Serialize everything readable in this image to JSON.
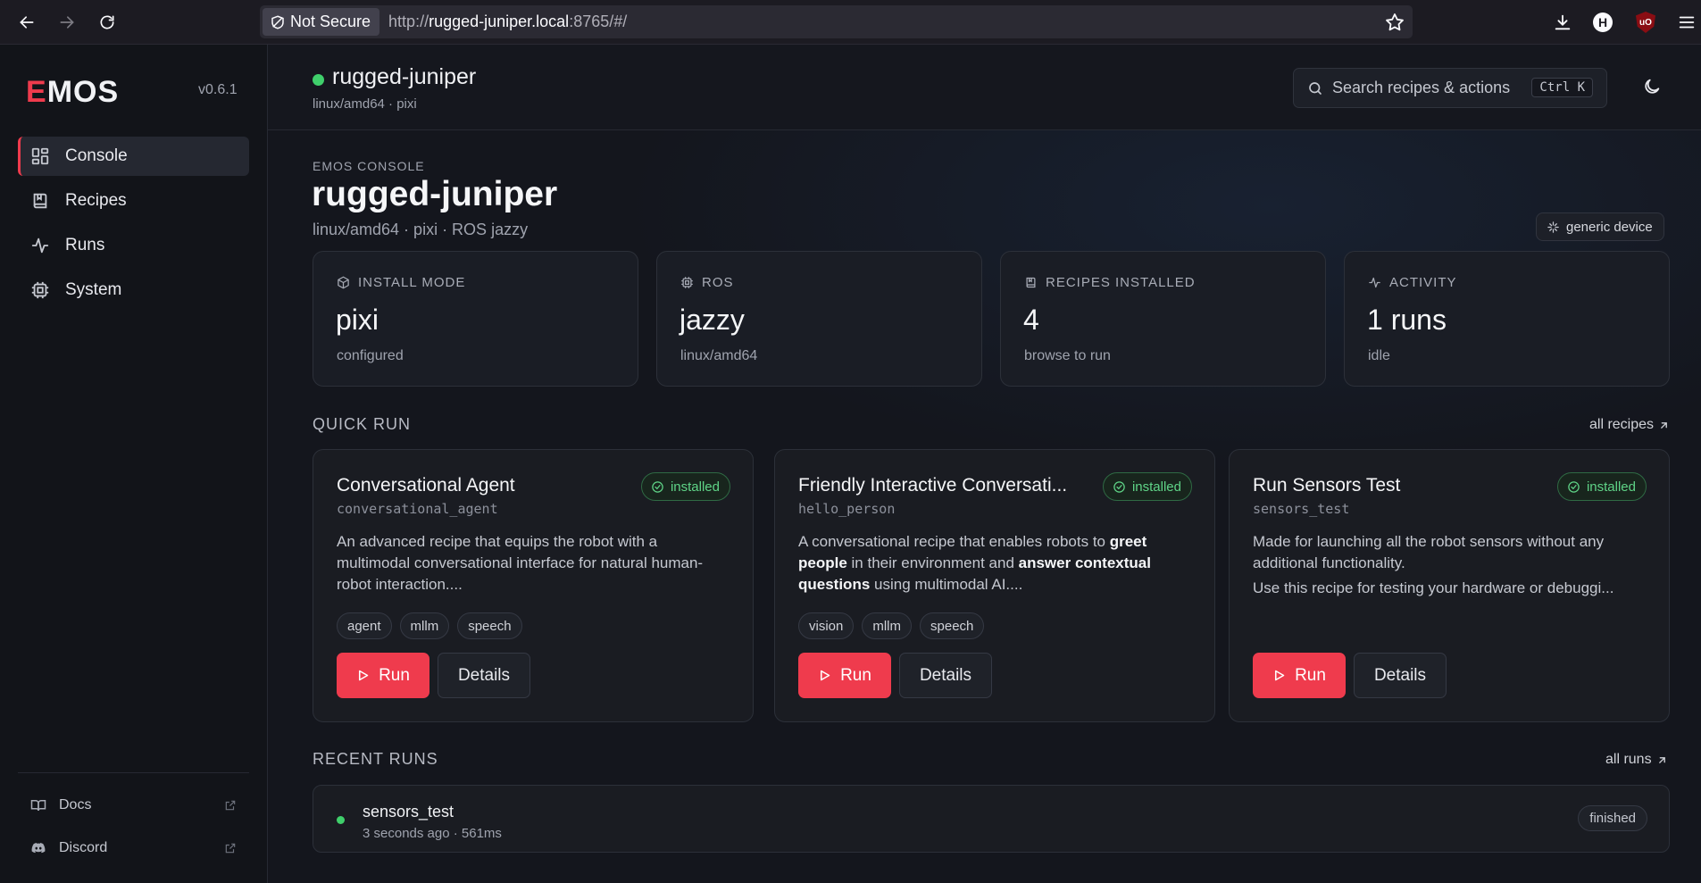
{
  "browser": {
    "security_label": "Not Secure",
    "url_prefix": "http://",
    "url_host": "rugged-juniper.local",
    "url_rest": ":8765/#/",
    "profile_initial": "H",
    "ublock_label": "uO"
  },
  "sidebar": {
    "logo_first": "E",
    "logo_rest": "MOS",
    "version": "v0.6.1",
    "items": [
      {
        "label": "Console",
        "icon": "grid-icon",
        "active": true
      },
      {
        "label": "Recipes",
        "icon": "book-icon",
        "active": false
      },
      {
        "label": "Runs",
        "icon": "activity-icon",
        "active": false
      },
      {
        "label": "System",
        "icon": "cpu-icon",
        "active": false
      }
    ],
    "footer_links": [
      {
        "label": "Docs",
        "icon": "book-open-icon"
      },
      {
        "label": "Discord",
        "icon": "discord-icon"
      }
    ]
  },
  "header": {
    "device_name": "rugged-juniper",
    "device_sub": "linux/amd64 · pixi",
    "search_placeholder": "Search recipes & actions",
    "search_shortcut": "Ctrl K"
  },
  "console": {
    "eyebrow": "EMOS CONSOLE",
    "title": "rugged-juniper",
    "subtitle": "linux/amd64 · pixi · ROS jazzy",
    "device_badge": "generic device"
  },
  "stats": [
    {
      "label": "INSTALL MODE",
      "value": "pixi",
      "caption": "configured",
      "icon": "package-icon"
    },
    {
      "label": "ROS",
      "value": "jazzy",
      "caption": "linux/amd64",
      "icon": "chip-icon"
    },
    {
      "label": "RECIPES INSTALLED",
      "value": "4",
      "caption": "browse to run",
      "icon": "book-icon"
    },
    {
      "label": "ACTIVITY",
      "value": "1 runs",
      "caption": "idle",
      "icon": "activity-icon"
    }
  ],
  "quick_run": {
    "label": "QUICK RUN",
    "link": "all recipes",
    "run_label": "Run",
    "details_label": "Details",
    "recipes": [
      {
        "title": "Conversational Agent",
        "slug": "conversational_agent",
        "status": "installed",
        "desc_1": "An advanced recipe that equips the robot with a multimodal conversational interface for natural human-robot interaction....",
        "tags": [
          "agent",
          "mllm",
          "speech"
        ]
      },
      {
        "title": "Friendly Interactive Conversati...",
        "slug": "hello_person",
        "status": "installed",
        "desc_a": "A conversational recipe that enables robots to ",
        "desc_b": "greet people",
        "desc_c": " in their environment and ",
        "desc_d": "answer contextual questions",
        "desc_e": " using multimodal AI....",
        "tags": [
          "vision",
          "mllm",
          "speech"
        ]
      },
      {
        "title": "Run Sensors Test",
        "slug": "sensors_test",
        "status": "installed",
        "desc_1": "Made for launching all the robot sensors without any additional functionality.",
        "desc_2": "Use this recipe for testing your hardware or debuggi...",
        "tags": []
      }
    ]
  },
  "recent_runs": {
    "label": "RECENT RUNS",
    "link": "all runs",
    "runs": [
      {
        "name": "sensors_test",
        "meta": "3 seconds ago · 561ms",
        "status": "finished"
      }
    ]
  },
  "colors": {
    "accent": "#ef3b4d",
    "success": "#3fcf6b",
    "background": "#14161d"
  }
}
